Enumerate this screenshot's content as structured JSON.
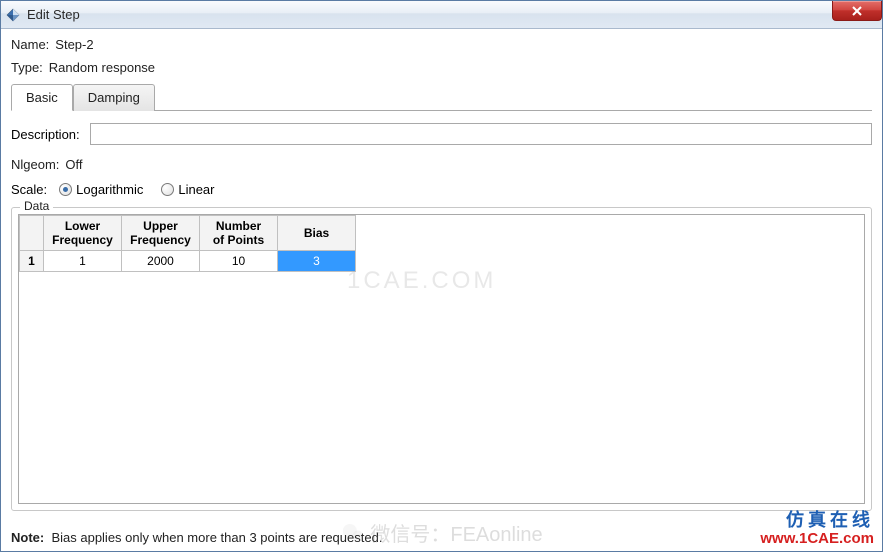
{
  "window": {
    "title": "Edit Step"
  },
  "form": {
    "name_label": "Name:",
    "name_value": "Step-2",
    "type_label": "Type:",
    "type_value": "Random response"
  },
  "tabs": {
    "basic": "Basic",
    "damping": "Damping"
  },
  "basic_tab": {
    "description_label": "Description:",
    "description_value": "",
    "nlgeom_label": "Nlgeom:",
    "nlgeom_value": "Off",
    "scale_label": "Scale:",
    "scale_options": {
      "logarithmic": "Logarithmic",
      "linear": "Linear"
    },
    "scale_selected": "logarithmic"
  },
  "data_section": {
    "legend": "Data",
    "columns": {
      "lower_freq": "Lower\nFrequency",
      "upper_freq": "Upper\nFrequency",
      "num_points": "Number\nof Points",
      "bias": "Bias"
    },
    "rows": [
      {
        "index": "1",
        "lower": "1",
        "upper": "2000",
        "points": "10",
        "bias": "3"
      }
    ]
  },
  "note": {
    "label": "Note:",
    "text": "Bias applies only when more than 3 points are requested."
  },
  "watermarks": {
    "faint": "1CAE.COM",
    "blue": "仿真在线",
    "red": "www.1CAE.com",
    "wx": "微信号：FEAonline"
  }
}
